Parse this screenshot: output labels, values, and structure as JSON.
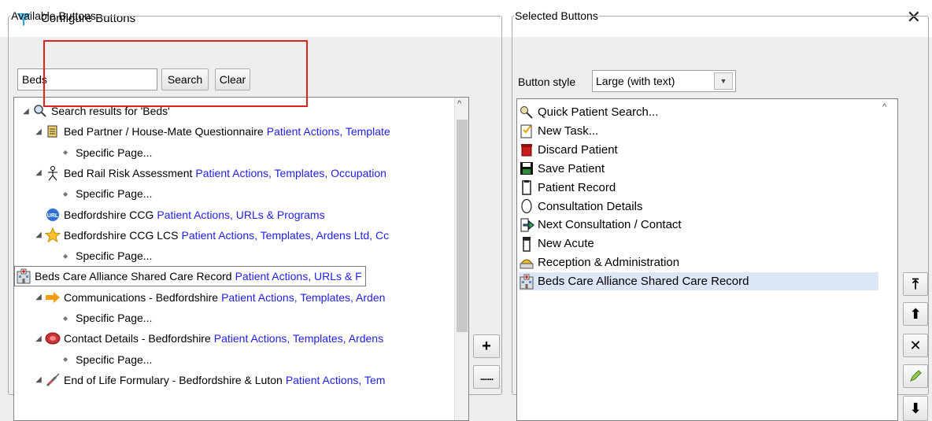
{
  "window": {
    "title": "Configure Buttons",
    "close_icon": "close-icon"
  },
  "available": {
    "legend": "Available Buttons",
    "search_value": "Beds",
    "search_button": "Search",
    "clear_button": "Clear",
    "tree": [
      {
        "kind": "root",
        "label": "Search results for 'Beds'",
        "icon": "search-icon"
      },
      {
        "kind": "item",
        "label": "Bed Partner / House-Mate Questionnaire",
        "cats": "Patient Actions, Template",
        "icon": "questionnaire-icon"
      },
      {
        "kind": "sub",
        "label": "Specific Page..."
      },
      {
        "kind": "item",
        "label": "Bed Rail Risk Assessment",
        "cats": "Patient Actions, Templates, Occupation",
        "icon": "person-icon"
      },
      {
        "kind": "sub",
        "label": "Specific Page..."
      },
      {
        "kind": "leaf",
        "label": "Bedfordshire CCG",
        "cats": "Patient Actions, URLs & Programs",
        "icon": "url-icon"
      },
      {
        "kind": "item",
        "label": "Bedfordshire CCG LCS",
        "cats": "Patient Actions, Templates, Ardens Ltd, Cc",
        "icon": "star-icon"
      },
      {
        "kind": "sub",
        "label": "Specific Page..."
      },
      {
        "kind": "selected",
        "label": "Beds Care Alliance Shared Care Record",
        "cats": "Patient Actions, URLs & F",
        "icon": "hospital-icon"
      },
      {
        "kind": "item",
        "label": "Communications - Bedfordshire",
        "cats": "Patient Actions, Templates, Arden",
        "icon": "arrow-right-icon"
      },
      {
        "kind": "sub",
        "label": "Specific Page..."
      },
      {
        "kind": "item",
        "label": "Contact Details - Bedfordshire",
        "cats": "Patient Actions, Templates, Ardens",
        "icon": "phone-icon"
      },
      {
        "kind": "sub",
        "label": "Specific Page..."
      },
      {
        "kind": "item",
        "label": "End of Life Formulary - Bedfordshire & Luton",
        "cats": "Patient Actions, Tem",
        "icon": "syringe-icon"
      }
    ]
  },
  "selected": {
    "legend": "Selected Buttons",
    "style_label": "Button style",
    "style_value": "Large (with text)",
    "items": [
      {
        "label": "Quick Patient Search...",
        "icon": "search-patient-icon"
      },
      {
        "label": "New Task...",
        "icon": "task-icon"
      },
      {
        "label": "Discard Patient",
        "icon": "discard-icon"
      },
      {
        "label": "Save Patient",
        "icon": "save-icon"
      },
      {
        "label": "Patient Record",
        "icon": "record-icon"
      },
      {
        "label": "Consultation Details",
        "icon": "consultation-icon"
      },
      {
        "label": "Next Consultation / Contact",
        "icon": "next-consultation-icon"
      },
      {
        "label": "New Acute",
        "icon": "acute-icon"
      },
      {
        "label": "Reception & Administration",
        "icon": "reception-icon"
      },
      {
        "label": "Beds Care Alliance Shared Care Record",
        "icon": "hospital-icon"
      }
    ]
  },
  "controls": {
    "add_symbol": "+",
    "remove_symbol": "—",
    "move_top": "⤒",
    "move_up": "⬆",
    "delete": "✕",
    "move_down": "⬇"
  },
  "colors": {
    "category_link": "#1f1fe6",
    "highlight_box": "#e0221b",
    "selected_row": "#dde6f7"
  }
}
